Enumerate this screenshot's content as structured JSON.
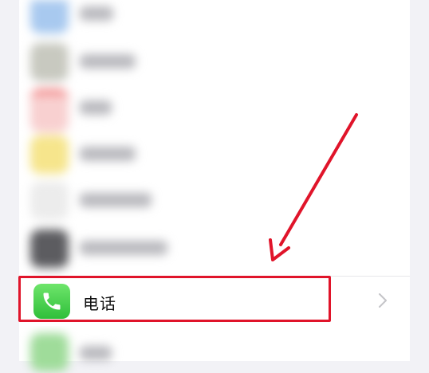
{
  "settings_list": {
    "phone_row": {
      "label": "电话",
      "icon": "phone-icon",
      "accent_color": "#34c759"
    },
    "blurred_rows": [
      {
        "icon_color": "#a8c9ef",
        "text_width": 42
      },
      {
        "icon_color": "#c8c9c0",
        "text_width": 70
      },
      {
        "icon_color": "#f5b2b2",
        "text_width": 40
      },
      {
        "icon_color": "#f6e58c",
        "text_width": 70
      },
      {
        "icon_color": "#ececec",
        "text_width": 90
      },
      {
        "icon_color": "#5c5c60",
        "text_width": 110
      },
      {
        "icon_color": "#9fdc9a",
        "text_width": 40
      }
    ]
  },
  "annotation": {
    "highlight_color": "#e0142a",
    "arrow_color": "#e0142a"
  }
}
